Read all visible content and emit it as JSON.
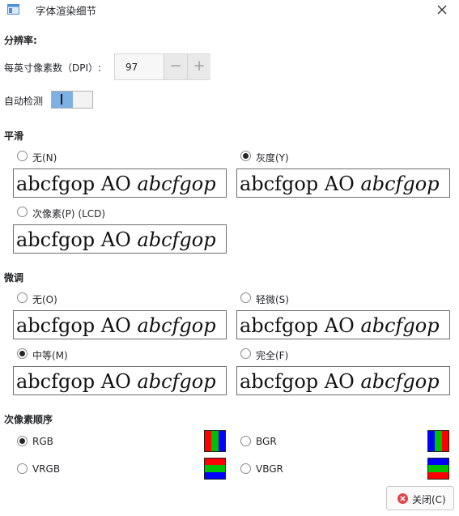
{
  "window": {
    "title": "字体渲染细节",
    "icon": "app-icon",
    "close_icon": "close-icon"
  },
  "resolution": {
    "heading": "分辨率:",
    "dpi_label": "每英寸像素数（DPI）:",
    "dpi_value": "97",
    "decrement": "−",
    "increment": "+",
    "auto_detect_label": "自动检测",
    "auto_detect_on": true
  },
  "preview_text": {
    "regular": "abcfgop AO ",
    "italic": "abcfgop"
  },
  "antialiasing": {
    "heading": "平滑",
    "options": [
      {
        "label": "无(N)",
        "checked": false
      },
      {
        "label": "灰度(Y)",
        "checked": true
      },
      {
        "label": "次像素(P) (LCD)",
        "checked": false
      }
    ]
  },
  "hinting": {
    "heading": "微调",
    "options": [
      {
        "label": "无(O)",
        "checked": false
      },
      {
        "label": "轻微(S)",
        "checked": false
      },
      {
        "label": "中等(M)",
        "checked": true
      },
      {
        "label": "完全(F)",
        "checked": false
      }
    ]
  },
  "subpixel_order": {
    "heading": "次像素顺序",
    "options": [
      {
        "label": "RGB",
        "checked": true,
        "colors": [
          "#ff0000",
          "#00c000",
          "#0000ff"
        ],
        "orientation": "horizontal"
      },
      {
        "label": "BGR",
        "checked": false,
        "colors": [
          "#0000ff",
          "#00c000",
          "#ff0000"
        ],
        "orientation": "horizontal"
      },
      {
        "label": "VRGB",
        "checked": false,
        "colors": [
          "#ff0000",
          "#00c000",
          "#0000ff"
        ],
        "orientation": "vertical"
      },
      {
        "label": "VBGR",
        "checked": false,
        "colors": [
          "#0000ff",
          "#00c000",
          "#ff0000"
        ],
        "orientation": "vertical"
      }
    ]
  },
  "footer": {
    "close_label": "关闭(C)",
    "close_icon": "cancel-icon",
    "close_icon_color": "#e0454a"
  }
}
